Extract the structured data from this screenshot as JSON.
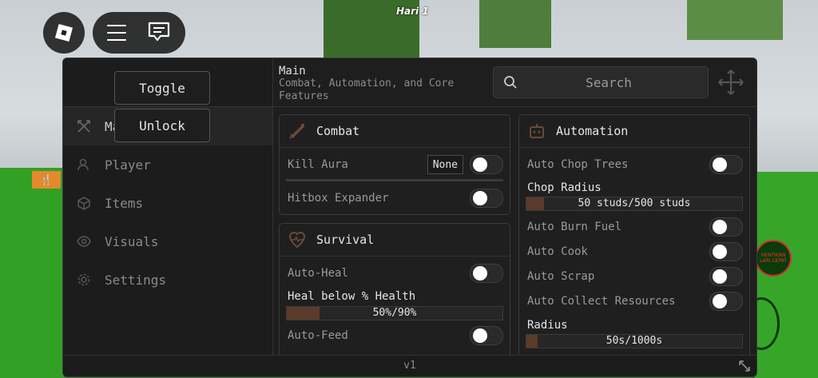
{
  "hud": {
    "day_label": "Hari 1",
    "stop_label": "HENTIKAN LARI CEPAT"
  },
  "popup": {
    "toggle_label": "Toggle",
    "unlock_label": "Unlock"
  },
  "header": {
    "title": "Main",
    "subtitle": "Combat, Automation, and Core Features",
    "search_placeholder": "Search"
  },
  "sidebar": {
    "items": [
      {
        "label": "Main",
        "icon": "swords-icon"
      },
      {
        "label": "Player",
        "icon": "user-icon"
      },
      {
        "label": "Items",
        "icon": "box-icon"
      },
      {
        "label": "Visuals",
        "icon": "eye-icon"
      },
      {
        "label": "Settings",
        "icon": "gear-icon"
      }
    ]
  },
  "combat": {
    "title": "Combat",
    "kill_aura": {
      "label": "Kill Aura",
      "keybind": "None"
    },
    "hitbox": {
      "label": "Hitbox Expander"
    }
  },
  "survival": {
    "title": "Survival",
    "auto_heal": {
      "label": "Auto-Heal"
    },
    "heal_slider": {
      "label": "Heal below % Health",
      "value_text": "50%/90%",
      "fill": 0.15
    },
    "auto_feed": {
      "label": "Auto-Feed"
    }
  },
  "automation": {
    "title": "Automation",
    "auto_chop": {
      "label": "Auto Chop Trees"
    },
    "chop_slider": {
      "label": "Chop Radius",
      "value_text": "50 studs/500 studs",
      "fill": 0.08
    },
    "auto_burn": {
      "label": "Auto Burn Fuel"
    },
    "auto_cook": {
      "label": "Auto Cook"
    },
    "auto_scrap": {
      "label": "Auto Scrap"
    },
    "auto_collect": {
      "label": "Auto Collect Resources"
    },
    "radius_slider": {
      "label": "Radius",
      "value_text": "50s/1000s",
      "fill": 0.05
    }
  },
  "footer": {
    "version": "v1"
  },
  "colors": {
    "accent": "#5a3a2a",
    "panel": "#1e1e1e"
  }
}
